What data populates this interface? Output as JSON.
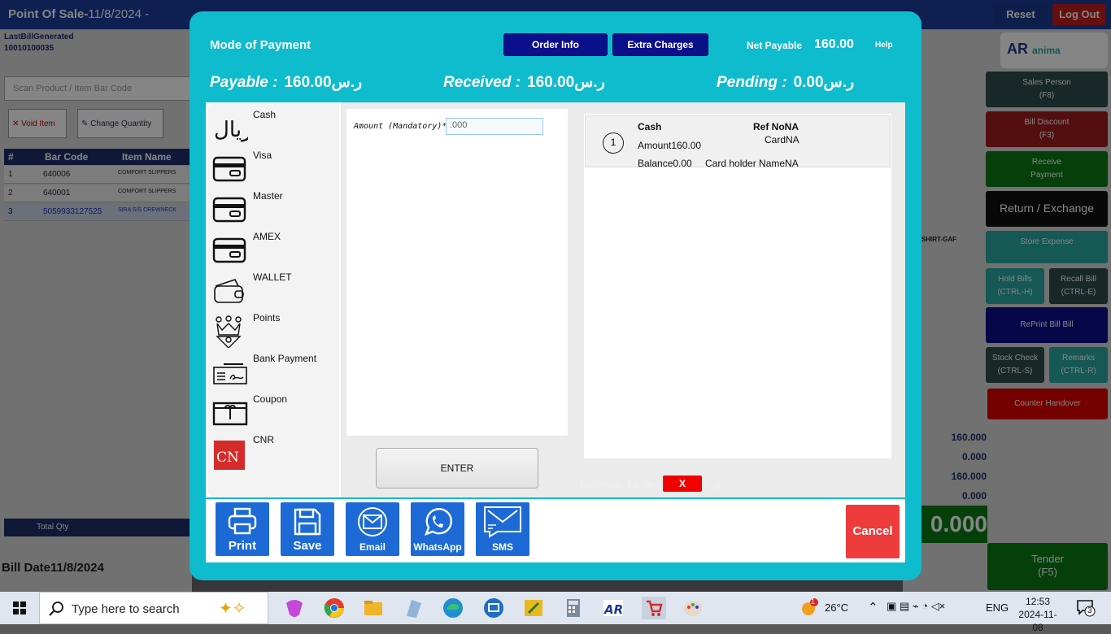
{
  "background": {
    "app_title": "Point Of Sale-",
    "app_date": "11/8/2024 -",
    "reset": "Reset",
    "logout": "Log Out",
    "last_bill_label": "LastBillGenerated",
    "last_bill_no": "10010100035",
    "scan_placeholder": "Scan Product / Item  Bar Code",
    "void_item": "Void Item",
    "change_qty": "Change Quantity",
    "grid_headers": [
      "#",
      "Bar Code",
      "Item Name"
    ],
    "grid_rows": [
      {
        "n": "1",
        "code": "640006",
        "name": "COMFORT SLIPPERS"
      },
      {
        "n": "2",
        "code": "640001",
        "name": "COMFORT SLIPPERS"
      },
      {
        "n": "3",
        "code": "5059933127525",
        "name": "SIRA S/S CREWNECK"
      }
    ],
    "total_qty": "Total Qty",
    "bill_date": "Bill Date11/8/2024",
    "right_buttons": [
      {
        "label": "Sales Person\n(F8)",
        "color": "#2f4c4c"
      },
      {
        "label": "Bill Discount\n(F3)",
        "color": "#a01e1e"
      },
      {
        "label": "Receive\nPayment",
        "color": "#0a7a14"
      },
      {
        "label": "Return / Exchange",
        "color": "#101010"
      },
      {
        "label": "Store Expense",
        "color": "#2aa9a4"
      }
    ],
    "hold_bills": "Hold Bills\n(CTRL-H)",
    "recall_bill": "Recall Bill\n(CTRL-E)",
    "reprint": "RePrint Bill Bill",
    "stock_check": "Stock Check\n(CTRL-S)",
    "remarks": "Remarks\n(CTRL-R)",
    "counter_handover": "Counter Handover",
    "tender": "Tender\n(F5)",
    "totals": [
      "160.000",
      "0.000",
      "160.000",
      "0.000"
    ],
    "big_total": "0.000",
    "tshirt": "S-TSHIRT-GAF"
  },
  "modal": {
    "title": "Mode of Payment",
    "order_info": "Order Info",
    "extra_charges": "Extra Charges",
    "net_payable_label": "Net Payable",
    "net_payable_value": "160.00",
    "help": "Help",
    "payable_label": "Payable  :",
    "payable_value": "ر.س160.00",
    "received_label": "Received  :",
    "received_value": "ر.س160.00",
    "pending_label": "Pending  :",
    "pending_value": "ر.س0.00",
    "methods": [
      {
        "label": "Cash",
        "icon": "riyal-icon"
      },
      {
        "label": "Visa",
        "icon": "card-icon"
      },
      {
        "label": "Master",
        "icon": "card-icon"
      },
      {
        "label": "AMEX",
        "icon": "card-icon"
      },
      {
        "label": "WALLET",
        "icon": "wallet-icon"
      },
      {
        "label": "Points",
        "icon": "points-icon"
      },
      {
        "label": "Bank Payment",
        "icon": "cheque-icon"
      },
      {
        "label": "Coupon",
        "icon": "coupon-icon"
      },
      {
        "label": "CNR",
        "icon": "cnr-icon"
      }
    ],
    "amount_label": "Amount (Mandatory)*",
    "amount_placeholder": ".000",
    "enter": "ENTER",
    "payment": {
      "index": "1",
      "method": "Cash",
      "ref": "Ref NoNA",
      "card": "CardNA",
      "amount": "Amount160.00",
      "balance": "Balance0.00",
      "card_holder": "Card holder NameNA"
    },
    "balance_return_label": "Balance to Return",
    "balance_return_value": "0.00  ر.س",
    "x_button": "X",
    "actions": [
      "Print",
      "Save",
      "Email",
      "WhatsApp",
      "SMS"
    ],
    "cancel": "Cancel"
  },
  "taskbar": {
    "search_placeholder": "Type here to search",
    "weather": "26°C",
    "language": "ENG",
    "time": "12:53",
    "date": "2024-11-08",
    "notif_count": "3",
    "weather_badge": "1"
  }
}
